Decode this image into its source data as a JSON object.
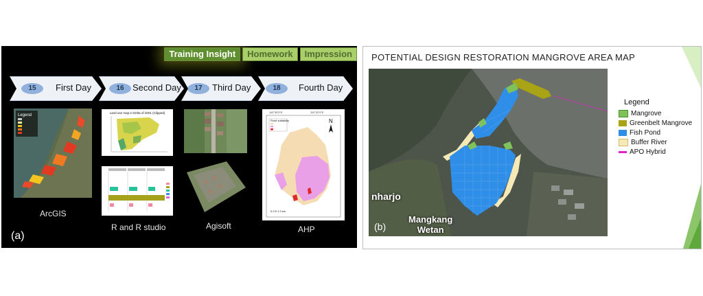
{
  "panel_a": {
    "tabs": [
      "Training Insight",
      "Homework",
      "Impression"
    ],
    "days": [
      {
        "num": "15",
        "label": "First Day"
      },
      {
        "num": "16",
        "label": "Second Day"
      },
      {
        "num": "17",
        "label": "Third Day"
      },
      {
        "num": "18",
        "label": "Fourth Day"
      }
    ],
    "captions": {
      "arcgis": "ArcGIS",
      "r": "R and R studio",
      "agisoft": "Agisoft",
      "ahp": "AHP"
    },
    "thumb_text": {
      "arcgis_legend_title": "Legend",
      "r_map_title": "Land use map in Delta of 2001 (Clipped)",
      "ahp_title": "Pond suitability",
      "ahp_north": "N",
      "ahp_scale": "0  0.5  1        2 km",
      "ahp_coord_left": "110°30'0\"E",
      "ahp_coord_right": "110°32'0\"E"
    },
    "label": "(a)"
  },
  "panel_b": {
    "title": "POTENTIAL DESIGN RESTORATION MANGROVE AREA MAP",
    "legend_title": "Legend",
    "legend": [
      {
        "label": "Mangrove",
        "color": "#7fc25a"
      },
      {
        "label": "Greenbelt Mangrove",
        "color": "#a9a316"
      },
      {
        "label": "Fish Pond",
        "color": "#2f8fe8"
      },
      {
        "label": "Buffer River",
        "color": "#f6e9b8"
      },
      {
        "label": "APO Hybrid",
        "color": "#e021c8"
      }
    ],
    "place_labels": [
      "nharjo",
      "Mangkang\nWetan"
    ],
    "label": "(b)"
  }
}
